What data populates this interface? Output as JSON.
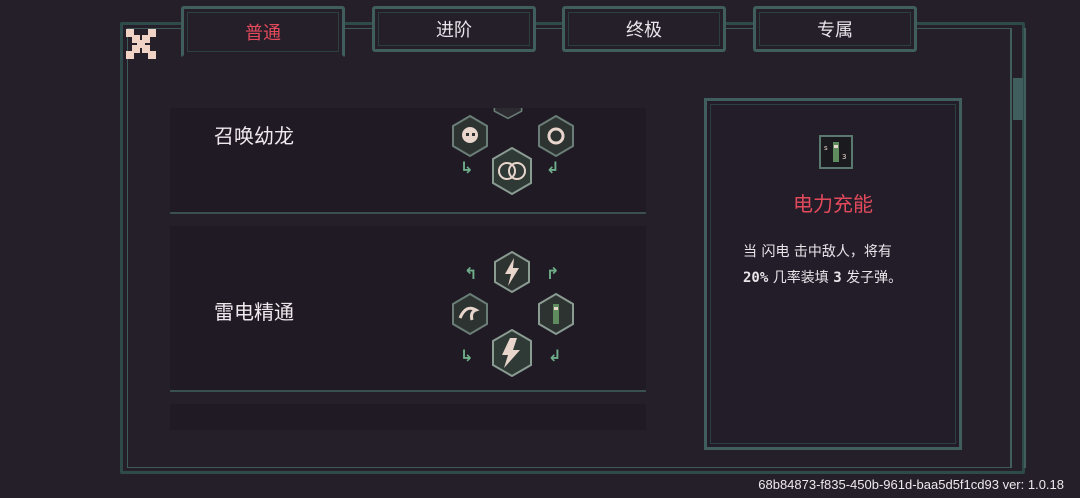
{
  "tabs": [
    {
      "label": "普通",
      "active": true
    },
    {
      "label": "进阶",
      "active": false
    },
    {
      "label": "终极",
      "active": false
    },
    {
      "label": "专属",
      "active": false
    }
  ],
  "skills": [
    {
      "name": "召唤幼龙"
    },
    {
      "name": "雷电精通"
    }
  ],
  "detail": {
    "title": "电力充能",
    "desc_part1": "当 闪电 击中敌人，将有",
    "chance": "20%",
    "desc_part2": " 几率装填 ",
    "count": "3",
    "desc_part3": " 发子弹。"
  },
  "footer": {
    "build_id": "68b84873-f835-450b-961d-baa5d5f1cd93 ver: 1.0.18"
  },
  "colors": {
    "accent": "#e24a5c",
    "frame": "#3f5e5d",
    "background": "#241f29"
  }
}
